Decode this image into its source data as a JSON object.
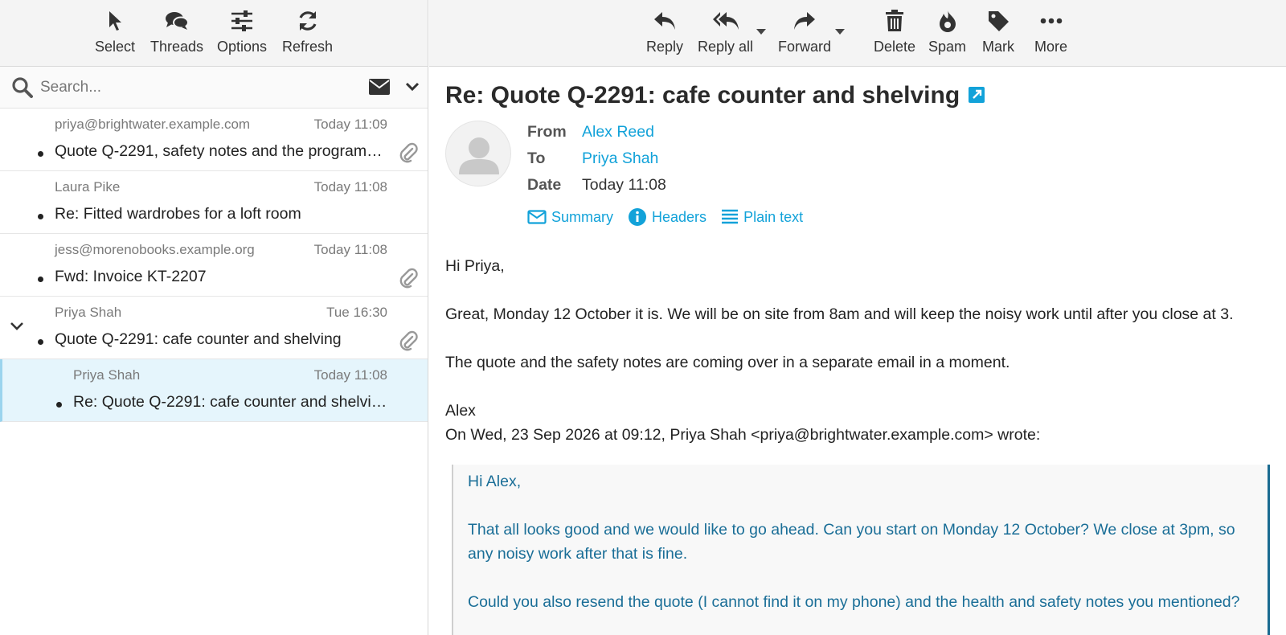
{
  "left_toolbar": {
    "select": "Select",
    "threads": "Threads",
    "options": "Options",
    "refresh": "Refresh"
  },
  "right_toolbar": {
    "reply": "Reply",
    "reply_all": "Reply all",
    "forward": "Forward",
    "delete": "Delete",
    "spam": "Spam",
    "mark": "Mark",
    "more": "More"
  },
  "search": {
    "placeholder": "Search..."
  },
  "messages": [
    {
      "from": "priya@brightwater.example.com",
      "date": "Today 11:09",
      "subject": "Quote Q-2291, safety notes and the programme",
      "attachment": true
    },
    {
      "from": "Laura Pike",
      "date": "Today 11:08",
      "subject": "Re: Fitted wardrobes for a loft room",
      "attachment": false
    },
    {
      "from": "jess@morenobooks.example.org",
      "date": "Today 11:08",
      "subject": "Fwd: Invoice KT-2207",
      "attachment": true
    },
    {
      "from": "Priya Shah",
      "date": "Tue 16:30",
      "subject": "Quote Q-2291: cafe counter and shelving",
      "attachment": true,
      "thread_expanded": true
    },
    {
      "from": "Priya Shah",
      "date": "Today 11:08",
      "subject": "Re: Quote Q-2291: cafe counter and shelving",
      "attachment": false,
      "selected": true
    }
  ],
  "email": {
    "subject": "Re: Quote Q-2291: cafe counter and shelving",
    "from_label": "From",
    "from": "Alex Reed",
    "to_label": "To",
    "to": "Priya Shah",
    "date_label": "Date",
    "date": "Today 11:08",
    "links": {
      "summary": "Summary",
      "headers": "Headers",
      "plain": "Plain text"
    },
    "body": {
      "greeting": "Hi Priya,",
      "p1": "Great, Monday 12 October it is. We will be on site from 8am and will keep the noisy work until after you close at 3.",
      "p2": "The quote and the safety notes are coming over in a separate email in a moment.",
      "signoff": "Alex",
      "attribution": "On Wed, 23 Sep 2026 at 09:12, Priya Shah <priya@brightwater.example.com> wrote:"
    },
    "quote": {
      "greeting": "Hi Alex,",
      "p1": "That all looks good and we would like to go ahead. Can you start on Monday 12 October? We close at 3pm, so any noisy work after that is fine.",
      "p2": "Could you also resend the quote (I cannot find it on my phone) and the health and safety notes you mentioned?"
    }
  },
  "colors": {
    "link": "#12a2d9",
    "quote_text": "#1a6e97",
    "selected_bg": "#e5f5fc"
  }
}
